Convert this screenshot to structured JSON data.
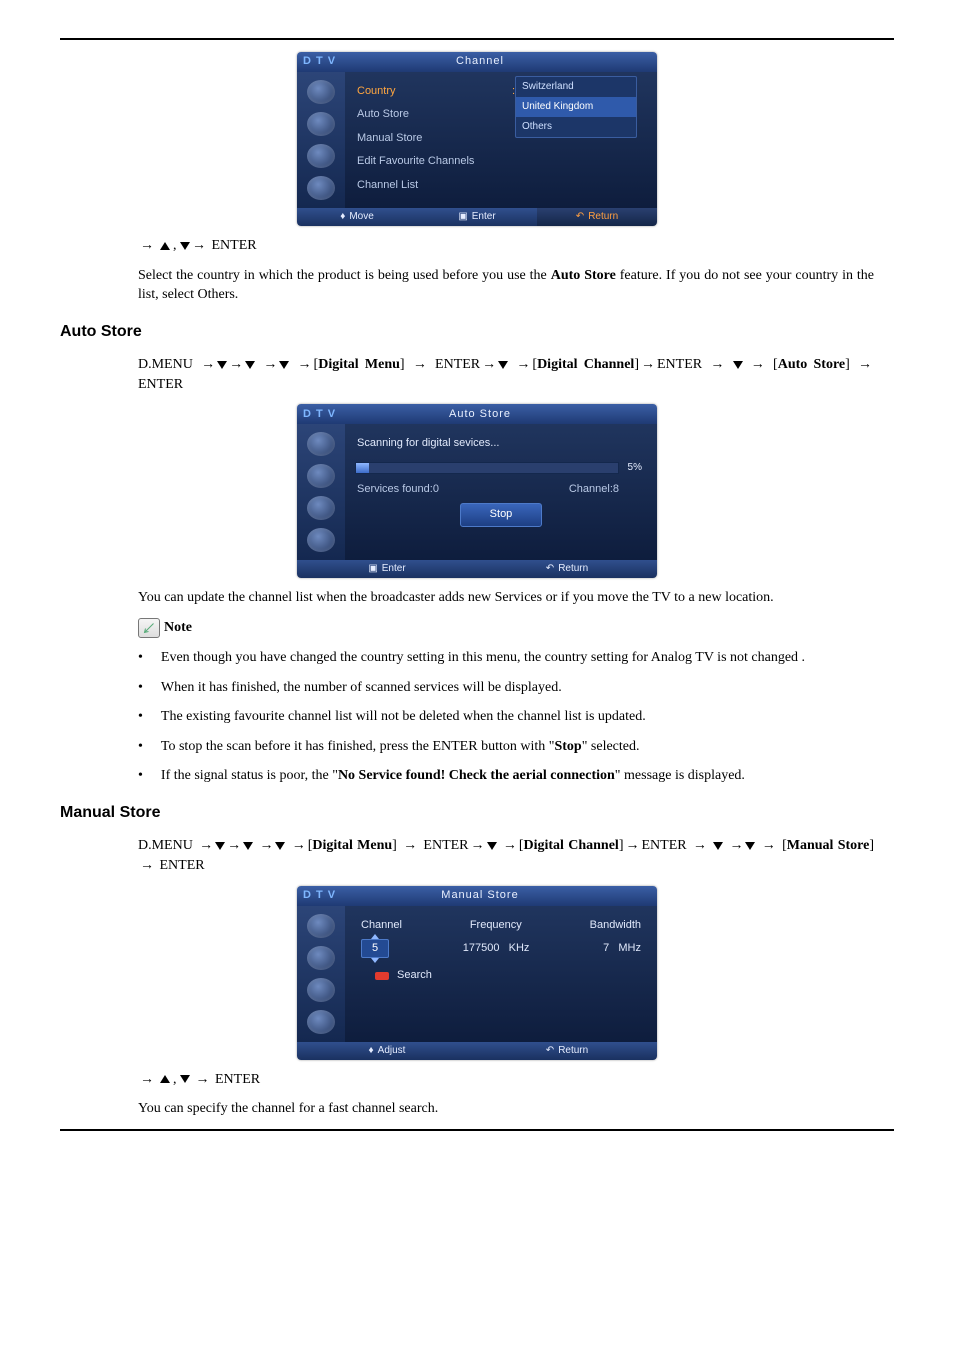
{
  "hr": true,
  "osd1": {
    "tag": "D T V",
    "title": "Channel",
    "items": [
      "Country",
      "Auto Store",
      "Manual Store",
      "Edit Favourite Channels",
      "Channel List"
    ],
    "selected_value": ":",
    "dropdown": [
      "Switzerland",
      "United Kingdom",
      "Others"
    ],
    "footer": {
      "move": "Move",
      "enter": "Enter",
      "return": "Return"
    }
  },
  "nav1": "→  ▲ , ▼ → ENTER",
  "para1": "Select the country in which the product is being used before you use the Auto Store feature. If you do not see your country in the list, select Others.",
  "heading_auto": "Auto Store",
  "path_auto_prefix": "D.MENU →",
  "path_auto_digital_menu": "Digital Menu",
  "path_auto_mid": "] → ENTER→",
  "path_auto_digital_channel": "Digital Channel",
  "path_auto_after": "]→ENTER → ",
  "path_auto_store": "Auto Store",
  "path_auto_end": "] → ENTER",
  "osd2": {
    "tag": "D T V",
    "title": "Auto Store",
    "scanning": "Scanning for digital sevices...",
    "progress_pct": "5%",
    "services_found_label": "Services found:0",
    "channel_label": "Channel:8",
    "stop": "Stop",
    "footer": {
      "enter": "Enter",
      "return": "Return"
    }
  },
  "para_auto": "You can update the channel list when the broadcaster adds new Services or if you move the TV to a new location.",
  "note_label": "Note",
  "bullets_auto": [
    "Even though you have changed the country setting in this menu, the country setting for Analog TV is not changed .",
    "When it has finished, the number of scanned services will be displayed.",
    "The existing favourite channel list will not be deleted when the channel list is updated.",
    "To stop the scan before it has finished, press the ENTER button with \"Stop\" selected.",
    "If the signal status is poor, the \"No Service found! Check the aerial connection\" message is displayed."
  ],
  "bold_stop": "Stop",
  "bold_nosvc": "No Service found! Check the aerial connection",
  "heading_manual": "Manual Store",
  "path_manual_store": "Manual Store",
  "osd3": {
    "tag": "D T V",
    "title": "Manual Store",
    "headers": {
      "channel": "Channel",
      "frequency": "Frequency",
      "bandwidth": "Bandwidth"
    },
    "channel_val": "5",
    "freq_val": "177500",
    "freq_unit": "KHz",
    "bw_val": "7",
    "bw_unit": "MHz",
    "search": "Search",
    "footer": {
      "adjust": "Adjust",
      "return": "Return"
    }
  },
  "nav2": "→  ▲ , ▼ → ENTER",
  "para_manual": "You can specify the channel for a fast channel search."
}
